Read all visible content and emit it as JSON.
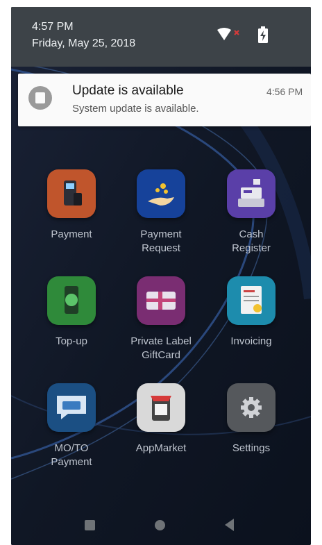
{
  "status_bar": {
    "time": "4:57 PM",
    "date": "Friday, May 25, 2018",
    "icons": [
      "wifi-icon",
      "no-sim-x-icon",
      "battery-charging-icon"
    ]
  },
  "notification": {
    "icon": "system-update-icon",
    "title": "Update is available",
    "text": "System update is available.",
    "time": "4:56 PM"
  },
  "apps": [
    {
      "label": "Payment",
      "icon": "payment-terminal-icon",
      "color": "#c0552c"
    },
    {
      "label": "Payment\nRequest",
      "icon": "hand-coins-icon",
      "color": "#16429a"
    },
    {
      "label": "Cash\nRegister",
      "icon": "cash-register-icon",
      "color": "#5a3fa8"
    },
    {
      "label": "Top-up",
      "icon": "phone-topup-icon",
      "color": "#2f8a3a"
    },
    {
      "label": "Private Label\nGiftCard",
      "icon": "gift-card-icon",
      "color": "#7a2d72"
    },
    {
      "label": "Invoicing",
      "icon": "invoice-icon",
      "color": "#1d8cad"
    },
    {
      "label": "MO/TO\nPayment",
      "icon": "chat-card-icon",
      "color": "#1b4f83"
    },
    {
      "label": "AppMarket",
      "icon": "app-store-icon",
      "color": "#d9d9d9"
    },
    {
      "label": "Settings",
      "icon": "gear-icon",
      "color": "#55585c"
    }
  ],
  "nav": {
    "buttons": [
      "recents-button",
      "home-button",
      "back-button"
    ]
  }
}
